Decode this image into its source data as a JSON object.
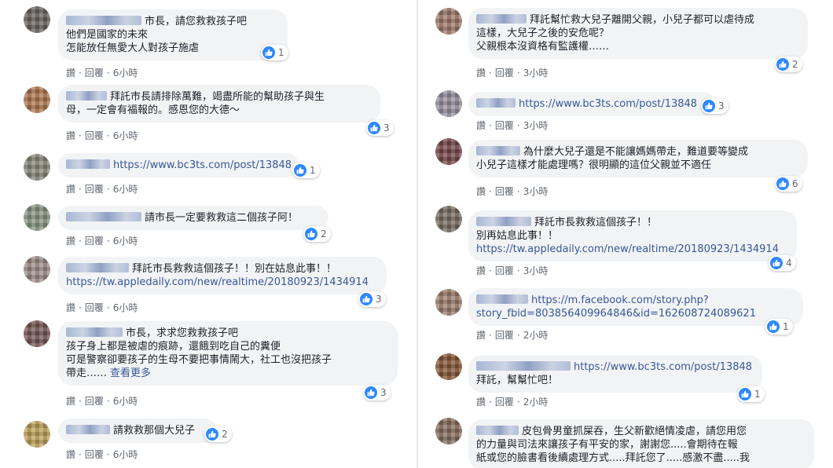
{
  "colors": {
    "background": "#e9ebee",
    "bubble": "#f2f3f5",
    "link": "#365899",
    "like": "#2d88ff",
    "meta": "#606770"
  },
  "icons": {
    "like": "thumbs-up-icon"
  },
  "left_comments": [
    {
      "lines": [
        "市長，請您救救孩子吧",
        "他們是國家的未來",
        "怎能放任無愛大人對孩子施虐"
      ],
      "reactions": "1",
      "like": "讚",
      "reply": "回覆",
      "time": "6小時"
    },
    {
      "lines": [
        "拜託市長請排除萬難，竭盡所能的幫助孩子與生",
        "母，一定會有福報的。感恩您的大德～"
      ],
      "reactions": "3",
      "like": "讚",
      "reply": "回覆",
      "time": "6小時"
    },
    {
      "lines": [
        "https://www.bc3ts.com/post/13848"
      ],
      "reactions": "1",
      "like": "讚",
      "reply": "回覆",
      "time": "6小時"
    },
    {
      "lines": [
        "請市長一定要救救這二個孩子阿！"
      ],
      "reactions": "2",
      "like": "讚",
      "reply": "回覆",
      "time": "6小時"
    },
    {
      "lines": [
        "拜託市長救救這個孩子！！別在姑息此事！！",
        "https://tw.appledaily.com/new/realtime/20180923/1434914"
      ],
      "reactions": "3",
      "like": "讚",
      "reply": "回覆",
      "time": "6小時"
    },
    {
      "lines": [
        "市長，求求您救救孩子吧",
        "孩子身上都是被虐的痕跡，還餓到吃自己的糞便",
        "可是警察卻要孩子的生母不要把事情鬧大，社工也沒把孩子",
        "帶走……"
      ],
      "more": "查看更多",
      "reactions": "3",
      "like": "讚",
      "reply": "回覆",
      "time": "6小時"
    },
    {
      "lines": [
        "請救救那個大兒子"
      ],
      "reactions": "2",
      "like": "讚",
      "reply": "回覆",
      "time": "6小時"
    }
  ],
  "right_comments": [
    {
      "lines": [
        "拜託幫忙救大兒子離開父親，小兒子都可以虐待成",
        "這樣，大兒子之後的安危呢？",
        "父親根本沒資格有監護權……"
      ],
      "reactions": "2",
      "like": "讚",
      "reply": "回覆",
      "time": "3小時"
    },
    {
      "lines": [
        "https://www.bc3ts.com/post/13848"
      ],
      "reactions": "3",
      "like": "讚",
      "reply": "回覆",
      "time": "3小時"
    },
    {
      "lines": [
        "為什麼大兒子還是不能讓媽媽帶走，難道要等變成",
        "小兒子這樣才能處理嗎？很明顯的這位父親並不適任"
      ],
      "reactions": "6",
      "like": "讚",
      "reply": "回覆",
      "time": "3小時"
    },
    {
      "lines": [
        "拜託市長救救這個孩子！！",
        "別再姑息此事！！",
        "https://tw.appledaily.com/new/realtime/20180923/1434914"
      ],
      "reactions": "4",
      "like": "讚",
      "reply": "回覆",
      "time": "3小時"
    },
    {
      "lines": [
        "https://m.facebook.com/story.php?",
        "story_fbid=803856409964846&id=162608724089621"
      ],
      "reactions": "1",
      "like": "讚",
      "reply": "回覆",
      "time": "2小時"
    },
    {
      "lines": [
        "https://www.bc3ts.com/post/13848",
        "拜託，幫幫忙吧！"
      ],
      "reactions": "1",
      "like": "讚",
      "reply": "回覆",
      "time": "2小時"
    },
    {
      "lines": [
        "皮包骨男童抓屎吞，生父新歡絕情凌虐，請您用您",
        "的力量與司法來讓孩子有平安的家，謝謝您.....會期待在報",
        "紙或您的臉書看後續處理方式.....拜託您了.....感激不盡.....我"
      ]
    }
  ]
}
